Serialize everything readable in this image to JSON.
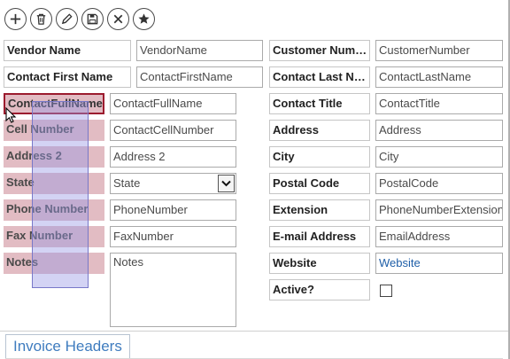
{
  "toolbar": {
    "buttons": [
      {
        "name": "add-record-button",
        "icon": "plus-icon"
      },
      {
        "name": "delete-record-button",
        "icon": "trash-icon"
      },
      {
        "name": "edit-record-button",
        "icon": "pencil-icon"
      },
      {
        "name": "save-record-button",
        "icon": "floppy-disk-icon"
      },
      {
        "name": "cancel-button",
        "icon": "close-icon"
      },
      {
        "name": "favorite-button",
        "icon": "star-icon"
      }
    ]
  },
  "labels": {
    "vendor_name": "Vendor Name",
    "contact_first_name": "Contact First Name",
    "contact_full_name": "ContactFullName",
    "cell_number": "Cell Number",
    "address_2": "Address 2",
    "state": "State",
    "phone_number": "Phone Number",
    "fax_number": "Fax Number",
    "notes": "Notes",
    "customer_number": "Customer Num…",
    "contact_last_name": "Contact Last N…",
    "contact_title": "Contact Title",
    "address": "Address",
    "city": "City",
    "postal_code": "Postal Code",
    "extension": "Extension",
    "email_address": "E-mail Address",
    "website": "Website",
    "active": "Active?"
  },
  "fields": {
    "vendor_name": "VendorName",
    "contact_first_name": "ContactFirstName",
    "contact_full_name": "ContactFullName",
    "cell_number": "ContactCellNumber",
    "address_2": "Address 2",
    "state": "State",
    "phone_number": "PhoneNumber",
    "fax_number": "FaxNumber",
    "notes": "Notes",
    "customer_number": "CustomerNumber",
    "contact_last_name": "ContactLastName",
    "contact_title": "ContactTitle",
    "address": "Address",
    "city": "City",
    "postal_code": "PostalCode",
    "extension": "PhoneNumberExtension",
    "email_address": "EmailAddress",
    "website": "Website",
    "active_checked": false
  },
  "tabs": {
    "invoice_headers": "Invoice Headers"
  },
  "colors": {
    "selected_label_border": "#9c1b2e",
    "tinted_label_bg": "#e2bcc3",
    "link": "#1f5fa8",
    "tab_text": "#3f7cbf",
    "drag_overlay": "#9696e4"
  }
}
